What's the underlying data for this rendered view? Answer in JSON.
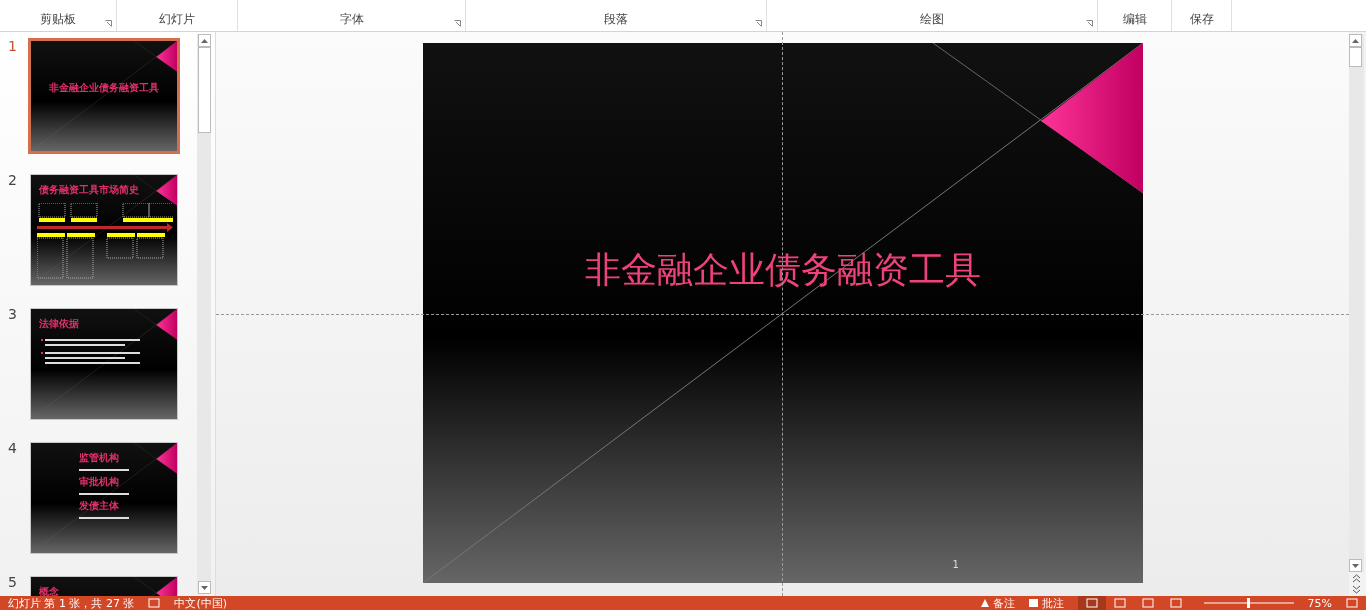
{
  "ribbon": {
    "groups": [
      {
        "label": "剪贴板",
        "launcher": true
      },
      {
        "label": "幻灯片",
        "launcher": false
      },
      {
        "label": "字体",
        "launcher": true
      },
      {
        "label": "段落",
        "launcher": true
      },
      {
        "label": "绘图",
        "launcher": true
      },
      {
        "label": "编辑",
        "launcher": false
      },
      {
        "label": "保存",
        "launcher": false
      }
    ]
  },
  "thumbnails": [
    {
      "number": "1",
      "selected": true,
      "kind": "title",
      "title": "非金融企业债务融资工具"
    },
    {
      "number": "2",
      "selected": false,
      "kind": "timeline",
      "title": "债务融资工具市场简史"
    },
    {
      "number": "3",
      "selected": false,
      "kind": "bullets",
      "title": "法律依据"
    },
    {
      "number": "4",
      "selected": false,
      "kind": "sections",
      "headings": [
        "监管机构",
        "审批机构",
        "发债主体"
      ]
    },
    {
      "number": "5",
      "selected": false,
      "kind": "heading",
      "title": "概念"
    }
  ],
  "slide": {
    "title": "非金融企业债务融资工具",
    "page_number": "1"
  },
  "status_bar": {
    "slide_info": "幻灯片 第 1 张，共 27 张",
    "language": "中文(中国)",
    "notes": "备注",
    "comments": "批注",
    "views": [
      {
        "selected": true
      },
      {
        "selected": false
      },
      {
        "selected": false
      },
      {
        "selected": false
      }
    ],
    "zoom": "75%"
  }
}
